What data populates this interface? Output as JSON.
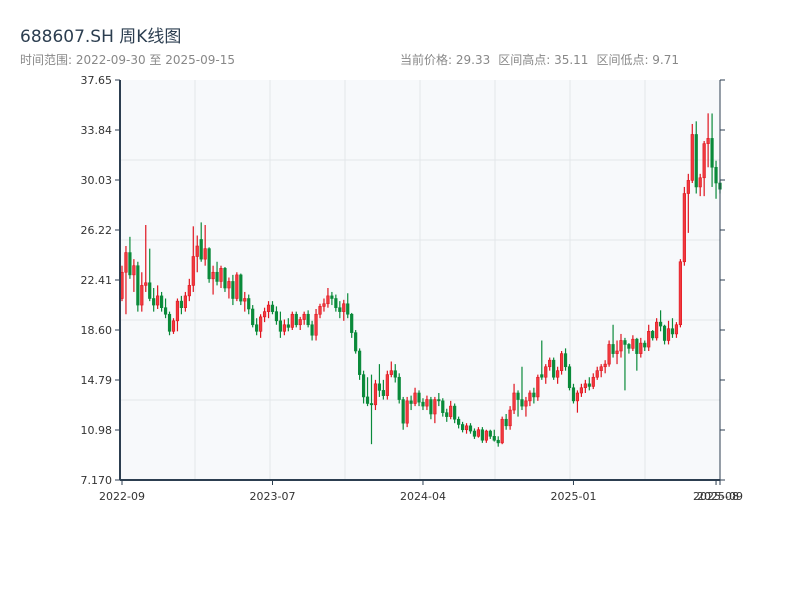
{
  "header": {
    "title": "688607.SH 周K线图",
    "range_label": "时间范围: 2022-09-30 至 2025-09-15",
    "current_price": "当前价格: 29.33",
    "range_high": "区间高点: 35.11",
    "range_low": "区间低点: 9.71"
  },
  "colors": {
    "up": "#e0141e",
    "down": "#0a8a3a",
    "axis": "#2c3e50",
    "plot_bg": "#f7f9fb",
    "grid": "#e3e6ea"
  },
  "chart_data": {
    "type": "candlestick",
    "title": "688607.SH 周K线图",
    "ylim": [
      7.17,
      37.65
    ],
    "y_ticks": [
      "7.170",
      "10.98",
      "14.79",
      "18.60",
      "22.41",
      "26.22",
      "30.03",
      "33.84",
      "37.65"
    ],
    "x_ticks": [
      {
        "label": "2022-09",
        "index": 0
      },
      {
        "label": "2023-07",
        "index": 38
      },
      {
        "label": "2024-04",
        "index": 76
      },
      {
        "label": "2025-01",
        "index": 114
      },
      {
        "label": "2025-08",
        "index": 150
      },
      {
        "label": "2025-09",
        "index": 151
      }
    ],
    "grid": true,
    "ohlc_fields": [
      "open",
      "high",
      "low",
      "close"
    ],
    "candles": [
      [
        21.0,
        23.5,
        20.8,
        23.0
      ],
      [
        23.0,
        25.0,
        19.8,
        24.5
      ],
      [
        24.5,
        25.7,
        22.5,
        22.8
      ],
      [
        22.8,
        24.0,
        21.5,
        23.5
      ],
      [
        23.5,
        23.8,
        20.0,
        20.5
      ],
      [
        20.5,
        23.0,
        20.0,
        22.0
      ],
      [
        22.0,
        26.6,
        21.5,
        22.2
      ],
      [
        22.2,
        24.8,
        20.8,
        21.0
      ],
      [
        21.0,
        21.8,
        20.0,
        20.5
      ],
      [
        20.5,
        22.0,
        20.2,
        21.2
      ],
      [
        21.2,
        21.5,
        20.0,
        20.3
      ],
      [
        20.3,
        21.0,
        19.5,
        19.8
      ],
      [
        19.8,
        20.0,
        18.2,
        18.5
      ],
      [
        18.5,
        19.5,
        18.3,
        19.3
      ],
      [
        19.3,
        21.0,
        18.5,
        20.8
      ],
      [
        20.8,
        21.2,
        19.8,
        20.3
      ],
      [
        20.3,
        21.5,
        20.0,
        21.2
      ],
      [
        21.2,
        22.5,
        20.8,
        22.0
      ],
      [
        22.0,
        26.5,
        21.5,
        24.2
      ],
      [
        24.2,
        25.8,
        23.0,
        25.0
      ],
      [
        25.5,
        26.8,
        23.8,
        24.0
      ],
      [
        24.0,
        26.6,
        23.5,
        24.8
      ],
      [
        24.8,
        24.9,
        22.2,
        22.5
      ],
      [
        22.5,
        23.5,
        21.3,
        23.0
      ],
      [
        23.0,
        23.8,
        22.0,
        22.3
      ],
      [
        22.3,
        23.5,
        21.8,
        23.3
      ],
      [
        23.3,
        23.4,
        21.5,
        21.8
      ],
      [
        21.8,
        22.6,
        21.0,
        22.3
      ],
      [
        22.3,
        22.8,
        20.5,
        21.0
      ],
      [
        21.0,
        23.0,
        20.8,
        22.8
      ],
      [
        22.8,
        22.9,
        20.5,
        20.8
      ],
      [
        20.8,
        21.5,
        20.0,
        21.0
      ],
      [
        21.0,
        21.3,
        19.8,
        20.2
      ],
      [
        20.2,
        20.5,
        18.8,
        19.0
      ],
      [
        19.0,
        19.5,
        18.2,
        18.5
      ],
      [
        18.5,
        19.8,
        18.0,
        19.6
      ],
      [
        19.6,
        20.3,
        19.2,
        20.0
      ],
      [
        20.0,
        20.8,
        19.5,
        20.5
      ],
      [
        20.5,
        20.8,
        19.8,
        20.0
      ],
      [
        20.0,
        20.4,
        19.0,
        19.3
      ],
      [
        19.3,
        20.0,
        18.0,
        18.5
      ],
      [
        18.5,
        19.4,
        18.2,
        19.0
      ],
      [
        19.0,
        19.5,
        18.5,
        18.8
      ],
      [
        18.8,
        20.0,
        18.6,
        19.8
      ],
      [
        19.8,
        20.0,
        18.8,
        19.0
      ],
      [
        19.0,
        19.6,
        18.6,
        19.4
      ],
      [
        19.4,
        20.0,
        19.0,
        19.8
      ],
      [
        19.8,
        20.1,
        18.8,
        19.0
      ],
      [
        19.0,
        19.3,
        17.8,
        18.2
      ],
      [
        18.2,
        20.2,
        17.8,
        19.8
      ],
      [
        19.8,
        20.6,
        19.5,
        20.4
      ],
      [
        20.4,
        21.0,
        20.0,
        20.6
      ],
      [
        20.6,
        21.8,
        20.3,
        21.2
      ],
      [
        21.2,
        21.5,
        20.5,
        21.0
      ],
      [
        21.0,
        21.3,
        20.0,
        20.3
      ],
      [
        20.3,
        20.8,
        19.5,
        20.0
      ],
      [
        20.0,
        20.9,
        19.3,
        20.6
      ],
      [
        20.6,
        21.4,
        19.5,
        19.8
      ],
      [
        19.8,
        19.9,
        18.0,
        18.4
      ],
      [
        18.4,
        18.6,
        16.8,
        17.0
      ],
      [
        17.0,
        17.2,
        14.8,
        15.2
      ],
      [
        15.2,
        15.5,
        13.0,
        13.5
      ],
      [
        13.5,
        15.0,
        12.8,
        13.0
      ],
      [
        13.0,
        15.2,
        9.9,
        12.9
      ],
      [
        12.9,
        14.8,
        12.5,
        14.5
      ],
      [
        14.5,
        16.0,
        13.5,
        14.0
      ],
      [
        14.0,
        14.8,
        13.3,
        13.6
      ],
      [
        13.6,
        15.5,
        13.3,
        15.2
      ],
      [
        15.2,
        16.2,
        15.0,
        15.5
      ],
      [
        15.5,
        16.0,
        14.6,
        15.0
      ],
      [
        15.0,
        15.3,
        13.0,
        13.3
      ],
      [
        13.3,
        13.5,
        11.0,
        11.5
      ],
      [
        11.5,
        13.5,
        11.2,
        13.2
      ],
      [
        13.2,
        13.6,
        12.5,
        13.0
      ],
      [
        13.0,
        14.2,
        12.8,
        13.8
      ],
      [
        13.8,
        14.0,
        12.8,
        13.1
      ],
      [
        13.1,
        13.4,
        12.5,
        12.8
      ],
      [
        12.8,
        13.6,
        12.5,
        13.3
      ],
      [
        13.3,
        13.5,
        11.8,
        12.2
      ],
      [
        12.2,
        13.5,
        11.5,
        13.3
      ],
      [
        13.3,
        13.8,
        12.8,
        13.2
      ],
      [
        13.2,
        13.4,
        12.0,
        12.3
      ],
      [
        12.3,
        12.6,
        11.6,
        12.0
      ],
      [
        12.0,
        13.2,
        11.8,
        12.8
      ],
      [
        12.8,
        13.0,
        11.5,
        11.8
      ],
      [
        11.8,
        12.0,
        11.1,
        11.4
      ],
      [
        11.4,
        11.6,
        10.8,
        11.0
      ],
      [
        11.0,
        11.5,
        10.7,
        11.3
      ],
      [
        11.3,
        11.5,
        10.7,
        10.9
      ],
      [
        10.9,
        11.1,
        10.3,
        10.5
      ],
      [
        10.5,
        11.2,
        10.4,
        11.0
      ],
      [
        11.0,
        11.2,
        10.0,
        10.2
      ],
      [
        10.2,
        11.0,
        10.0,
        10.9
      ],
      [
        10.9,
        11.0,
        10.3,
        10.5
      ],
      [
        10.5,
        11.0,
        10.1,
        10.2
      ],
      [
        10.2,
        10.5,
        9.71,
        10.0
      ],
      [
        10.0,
        12.0,
        9.9,
        11.8
      ],
      [
        11.8,
        12.2,
        11.0,
        11.3
      ],
      [
        11.3,
        12.8,
        11.0,
        12.5
      ],
      [
        12.5,
        14.5,
        12.2,
        13.8
      ],
      [
        13.8,
        14.0,
        12.0,
        13.3
      ],
      [
        13.3,
        15.8,
        12.5,
        12.8
      ],
      [
        12.8,
        13.5,
        12.0,
        13.2
      ],
      [
        13.2,
        14.0,
        12.8,
        13.8
      ],
      [
        13.8,
        14.2,
        13.0,
        13.5
      ],
      [
        13.5,
        15.2,
        13.2,
        15.0
      ],
      [
        15.2,
        17.8,
        14.8,
        15.0
      ],
      [
        15.0,
        16.0,
        14.5,
        15.8
      ],
      [
        15.8,
        16.5,
        15.5,
        16.3
      ],
      [
        16.3,
        16.5,
        14.8,
        15.0
      ],
      [
        15.0,
        15.8,
        14.5,
        15.5
      ],
      [
        15.5,
        17.0,
        15.2,
        16.8
      ],
      [
        16.8,
        17.2,
        15.5,
        15.8
      ],
      [
        15.8,
        16.0,
        14.0,
        14.2
      ],
      [
        14.2,
        14.5,
        13.0,
        13.2
      ],
      [
        13.2,
        14.0,
        12.3,
        13.8
      ],
      [
        13.8,
        14.5,
        13.5,
        14.2
      ],
      [
        14.2,
        14.8,
        13.8,
        14.5
      ],
      [
        14.5,
        15.0,
        14.0,
        14.3
      ],
      [
        14.3,
        15.3,
        14.1,
        15.0
      ],
      [
        15.0,
        15.8,
        14.8,
        15.5
      ],
      [
        15.5,
        16.0,
        15.0,
        15.8
      ],
      [
        15.8,
        16.3,
        15.3,
        16.0
      ],
      [
        16.0,
        17.8,
        15.8,
        17.5
      ],
      [
        17.5,
        19.0,
        16.5,
        16.8
      ],
      [
        16.8,
        17.8,
        16.0,
        17.0
      ],
      [
        17.0,
        18.3,
        16.5,
        17.8
      ],
      [
        17.8,
        18.0,
        14.0,
        17.5
      ],
      [
        17.5,
        17.6,
        16.8,
        17.2
      ],
      [
        17.2,
        18.2,
        17.0,
        17.9
      ],
      [
        17.9,
        18.0,
        15.5,
        16.8
      ],
      [
        16.8,
        18.0,
        16.5,
        17.6
      ],
      [
        17.6,
        17.8,
        17.0,
        17.3
      ],
      [
        17.3,
        19.0,
        17.0,
        18.5
      ],
      [
        18.5,
        18.6,
        17.8,
        18.0
      ],
      [
        18.0,
        19.5,
        17.8,
        19.2
      ],
      [
        19.2,
        20.1,
        18.5,
        18.9
      ],
      [
        18.9,
        19.0,
        17.5,
        17.8
      ],
      [
        17.8,
        19.3,
        17.5,
        18.7
      ],
      [
        18.7,
        19.5,
        18.0,
        18.3
      ],
      [
        18.3,
        19.2,
        18.0,
        19.0
      ],
      [
        19.0,
        24.0,
        18.8,
        23.8
      ],
      [
        23.8,
        29.5,
        23.5,
        29.0
      ],
      [
        29.0,
        30.5,
        26.0,
        30.0
      ],
      [
        30.0,
        34.3,
        29.8,
        33.5
      ],
      [
        33.5,
        34.5,
        29.0,
        29.5
      ],
      [
        29.5,
        30.5,
        28.8,
        30.2
      ],
      [
        30.2,
        33.0,
        28.8,
        32.8
      ],
      [
        32.8,
        35.11,
        31.0,
        33.2
      ],
      [
        33.2,
        35.1,
        29.5,
        31.0
      ],
      [
        31.0,
        31.5,
        28.6,
        29.8
      ],
      [
        29.8,
        30.0,
        29.0,
        29.33
      ]
    ]
  }
}
